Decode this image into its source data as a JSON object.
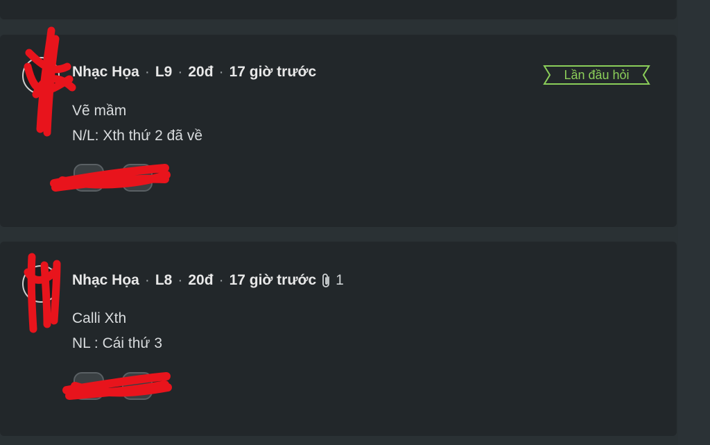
{
  "questions": [
    {
      "author": "Nhạc Họa",
      "level": "L9",
      "points": "20đ",
      "time": "17 giờ trước",
      "badge": "Lần đầu hỏi",
      "lines": [
        "Vẽ mầm",
        "N/L: Xth thứ 2 đã về"
      ]
    },
    {
      "author": "Nhạc Họa",
      "level": "L8",
      "points": "20đ",
      "time": "17 giờ trước",
      "attachment_count": "1",
      "lines": [
        "Calli Xth",
        "NL : Cái thứ 3"
      ]
    }
  ],
  "icons": {
    "attachment": "paperclip-icon"
  },
  "colors": {
    "badge": "#8ccf5a",
    "redaction": "#e8141c"
  }
}
